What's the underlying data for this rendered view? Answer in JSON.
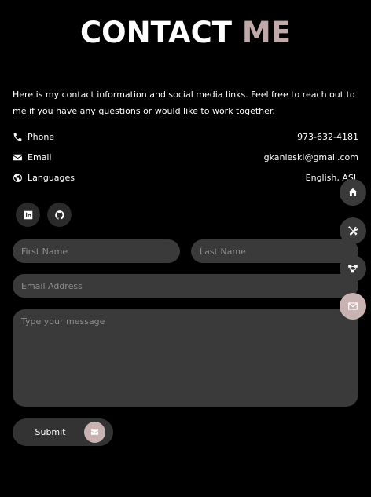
{
  "header": {
    "title_main": "CONTACT",
    "title_accent": "ME",
    "accent_color": "#c2a9a9"
  },
  "intro": "Here is my contact information and social media links. Feel free to reach out to me if you have any questions or would like to work together.",
  "contact": [
    {
      "icon": "phone-icon",
      "label": "Phone",
      "value": "973-632-4181"
    },
    {
      "icon": "envelope-icon",
      "label": "Email",
      "value": "gkanieski@gmail.com"
    },
    {
      "icon": "globe-icon",
      "label": "Languages",
      "value": "English, ASL"
    }
  ],
  "social": [
    {
      "icon": "linkedin-icon"
    },
    {
      "icon": "github-icon"
    }
  ],
  "form": {
    "first_name_placeholder": "First Name",
    "last_name_placeholder": "Last Name",
    "email_placeholder": "Email Address",
    "message_placeholder": "Type your message",
    "submit_label": "Submit"
  },
  "side_nav": [
    {
      "icon": "home-icon",
      "active": false
    },
    {
      "icon": "tools-icon",
      "active": false
    },
    {
      "icon": "share-nodes-icon",
      "active": false
    },
    {
      "icon": "envelope-icon",
      "active": true
    }
  ]
}
